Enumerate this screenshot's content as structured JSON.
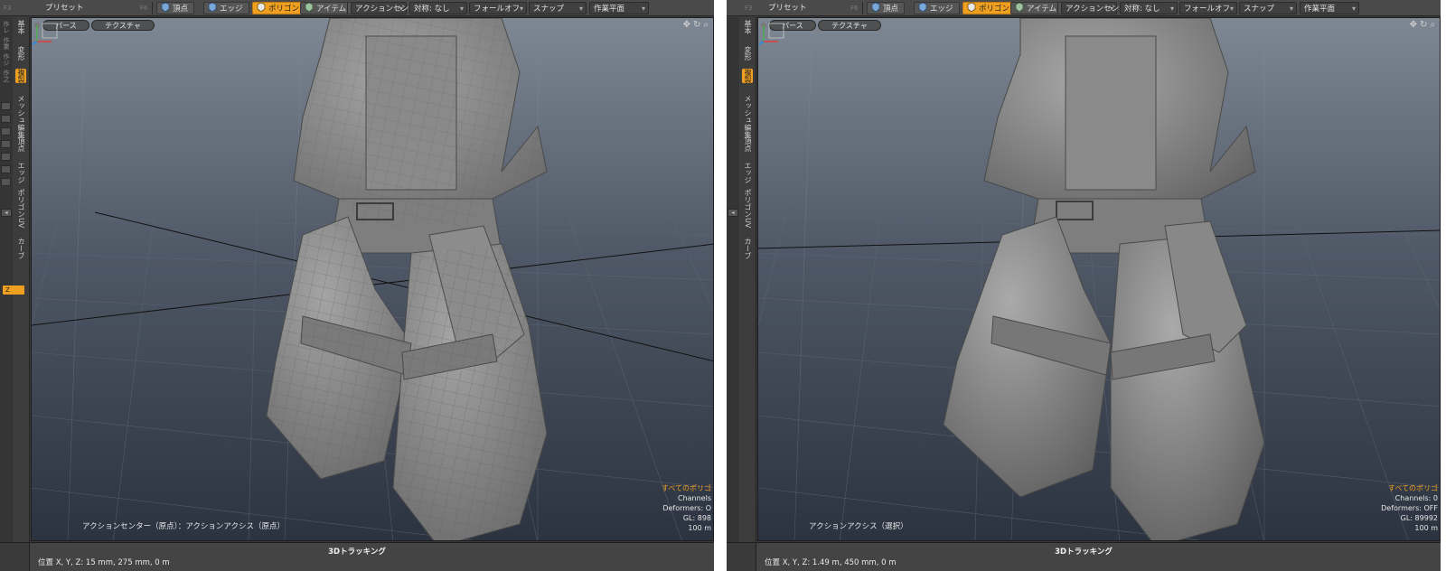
{
  "panels": [
    {
      "toolbar": {
        "f3": "F3",
        "preset": "プリセット",
        "f6": "F6",
        "vertex": "頂点",
        "edge": "エッジ",
        "polygon": "ポリゴン",
        "item": "アイテム",
        "action_center": "アクションセンター",
        "symmetry": "対称: なし",
        "falloff": "フォールオフ",
        "snap": "スナップ",
        "workplane": "作業平面"
      },
      "tabs": [
        "基本",
        "変形",
        "複製",
        "メッシュ編集",
        "頂点",
        "エッジ",
        "ポリゴン",
        "UV",
        "カーブ"
      ],
      "side_small": [
        "作レ",
        "作業",
        "作ジ",
        "作之"
      ],
      "z_label": "Z",
      "viewport": {
        "perspective": "パース",
        "texture": "テクスチャ",
        "action_text": "アクションセンター（原点）：アクションアクシス（原点）",
        "info": [
          "すべてのポリゴ",
          "Channels",
          "Deformers: O",
          "GL: 898",
          "100 m"
        ]
      },
      "status": {
        "title": "3Dトラッキング",
        "position": "位置 X, Y, Z:   15 mm, 275 mm, 0 m"
      }
    },
    {
      "toolbar": {
        "f3": "F3",
        "preset": "プリセット",
        "f6": "F6",
        "vertex": "頂点",
        "edge": "エッジ",
        "polygon": "ポリゴン",
        "item": "アイテム",
        "action_center": "アクションセンター",
        "symmetry": "対称: なし",
        "falloff": "フォールオフ",
        "snap": "スナップ",
        "workplane": "作業平面"
      },
      "tabs": [
        "基本",
        "変形",
        "複製",
        "メッシュ編集",
        "頂点",
        "エッジ",
        "ポリゴン",
        "UV",
        "カーブ"
      ],
      "side_small": [],
      "z_label": "",
      "viewport": {
        "perspective": "パース",
        "texture": "テクスチャ",
        "action_text": "アクションアクシス（選択）",
        "info": [
          "すべてのポリゴ",
          "Channels: 0",
          "Deformers: OFF",
          "GL: 89992",
          "100 m"
        ]
      },
      "status": {
        "title": "3Dトラッキング",
        "position": "位置 X, Y, Z:   1.49 m, 450 mm, 0 m"
      }
    }
  ],
  "colors": {
    "accent": "#f0a020",
    "viewport_top": "#7e8794",
    "viewport_bottom": "#2c3340",
    "model": "#8d8d8d"
  }
}
